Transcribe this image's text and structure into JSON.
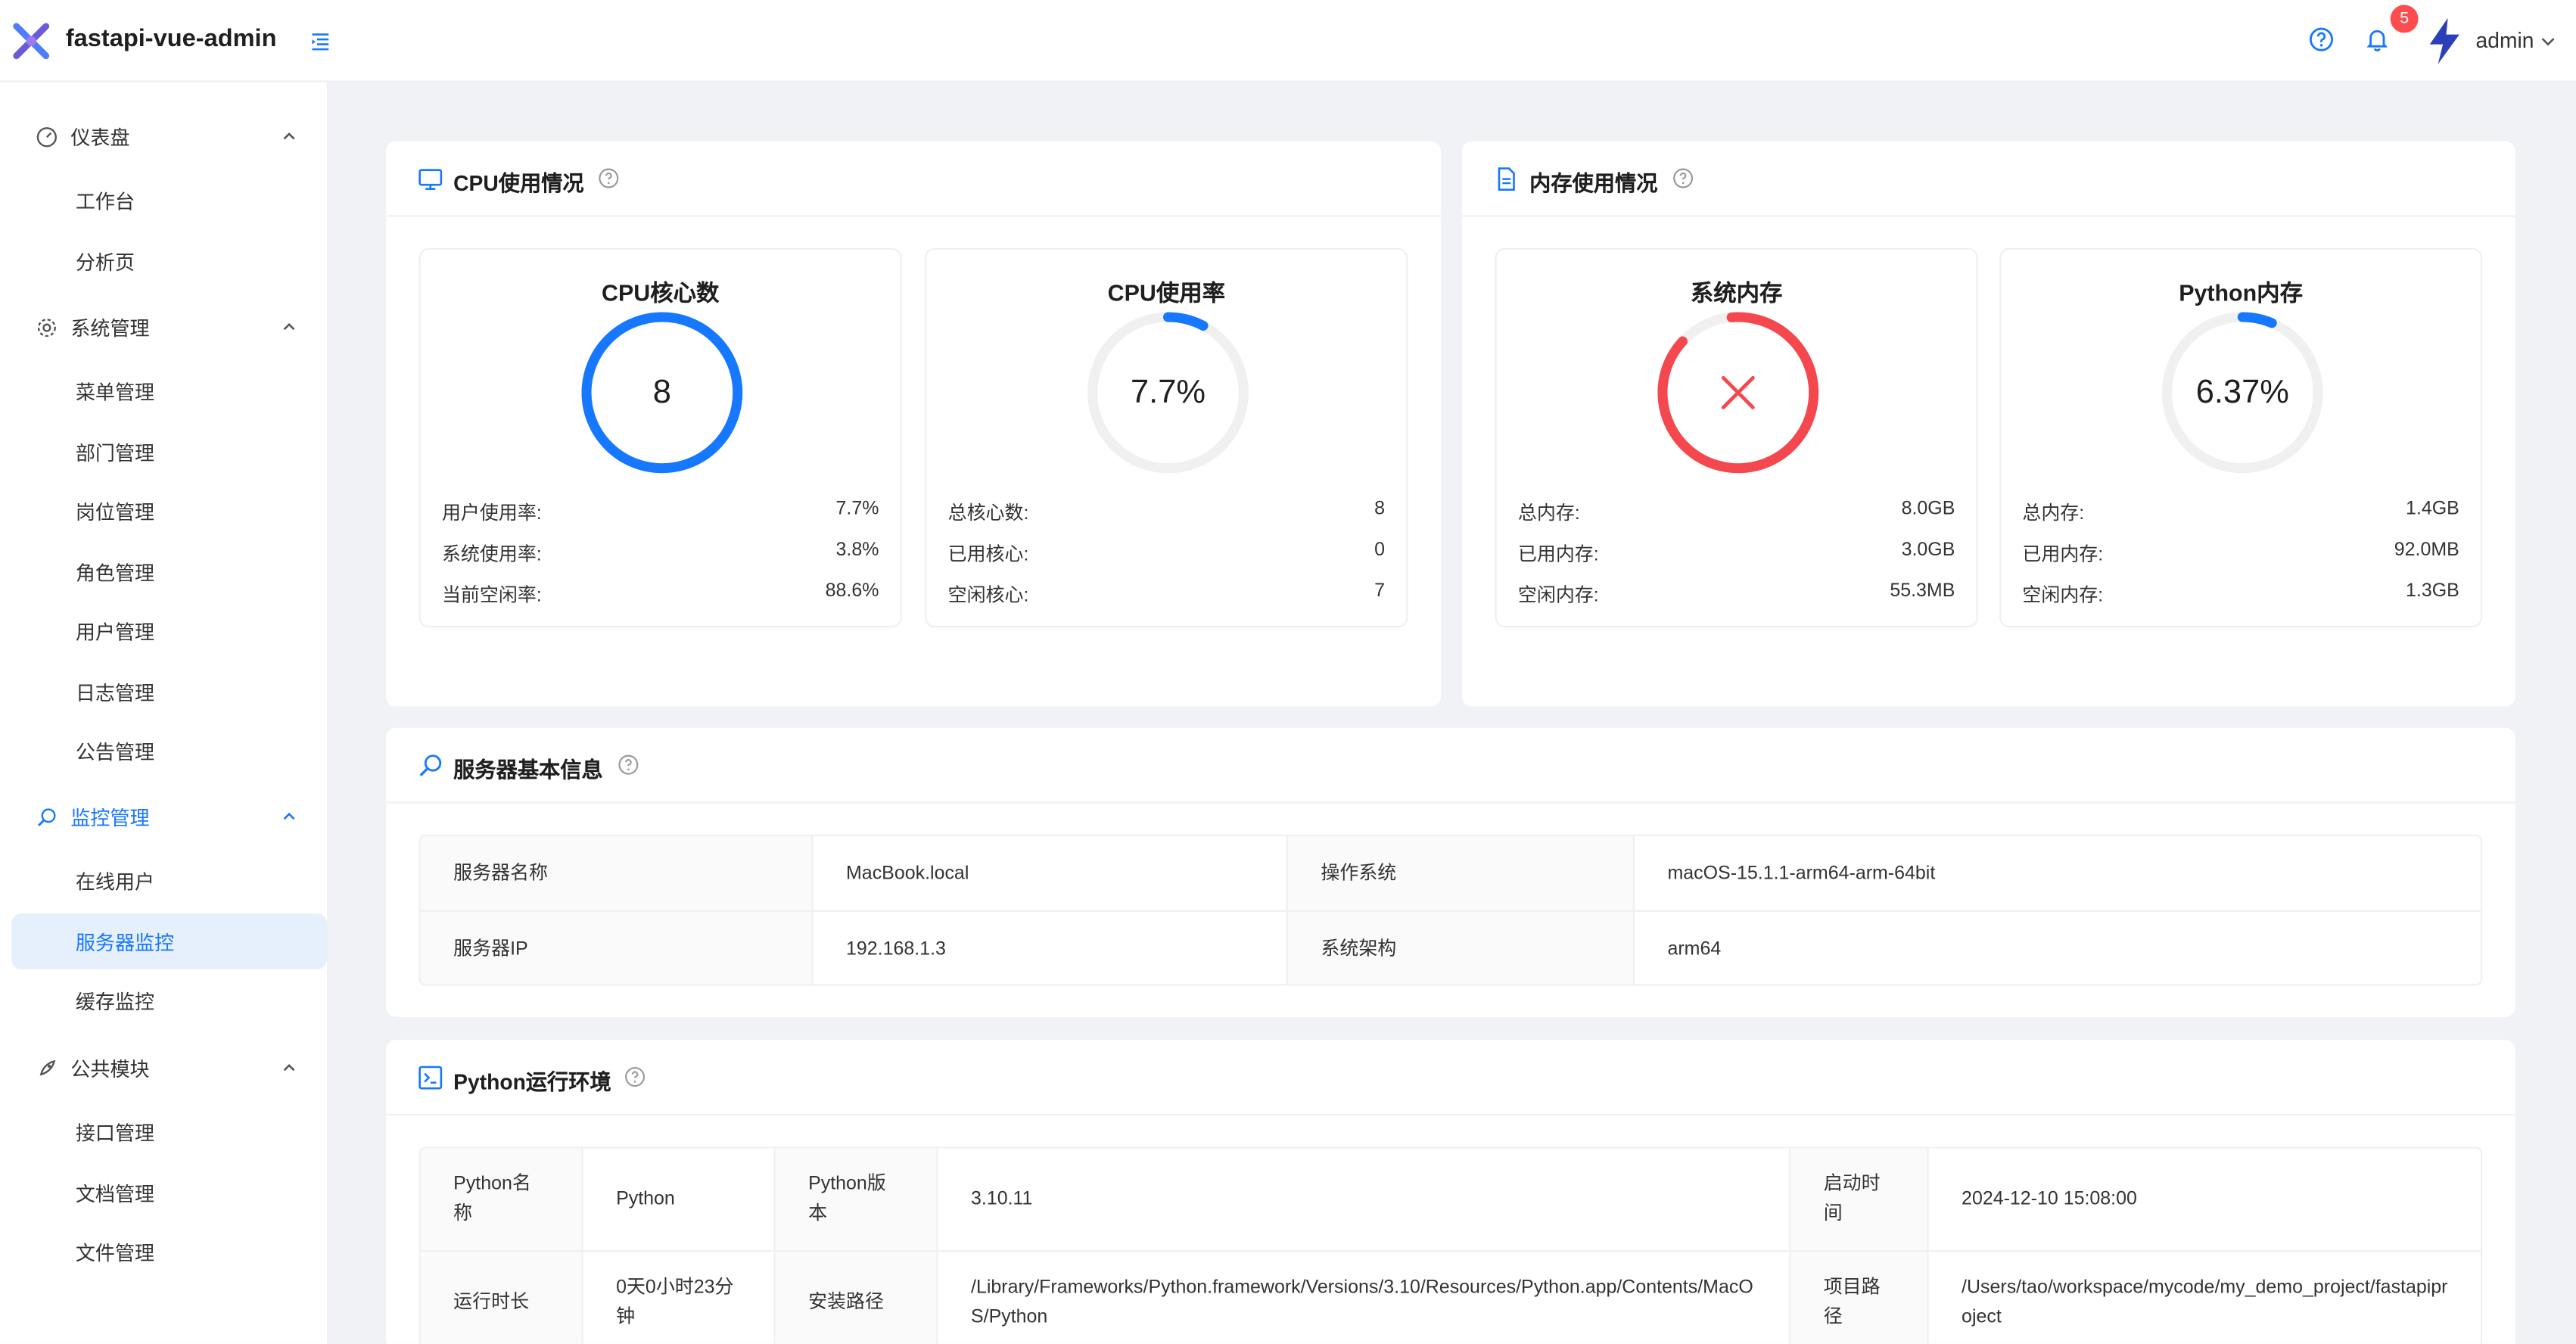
{
  "app": {
    "title": "fastapi-vue-admin"
  },
  "header": {
    "notification_count": "5",
    "user_name": "admin"
  },
  "sidebar": {
    "groups": [
      {
        "label": "仪表盘",
        "items": [
          "工作台",
          "分析页"
        ]
      },
      {
        "label": "系统管理",
        "items": [
          "菜单管理",
          "部门管理",
          "岗位管理",
          "角色管理",
          "用户管理",
          "日志管理",
          "公告管理"
        ]
      },
      {
        "label": "监控管理",
        "items": [
          "在线用户",
          "服务器监控",
          "缓存监控"
        ]
      },
      {
        "label": "公共模块",
        "items": [
          "接口管理",
          "文档管理",
          "文件管理"
        ]
      }
    ],
    "selected": "服务器监控"
  },
  "cpu_card": {
    "title": "CPU使用情况",
    "cores_box": {
      "title": "CPU核心数",
      "gauge_value": "8",
      "rows": [
        [
          "用户使用率:",
          "7.7%"
        ],
        [
          "系统使用率:",
          "3.8%"
        ],
        [
          "当前空闲率:",
          "88.6%"
        ]
      ]
    },
    "usage_box": {
      "title": "CPU使用率",
      "gauge_value": "7.7%",
      "percent": 7.7,
      "rows": [
        [
          "总核心数:",
          "8"
        ],
        [
          "已用核心:",
          "0"
        ],
        [
          "空闲核心:",
          "7"
        ]
      ]
    }
  },
  "memory_card": {
    "title": "内存使用情况",
    "system_box": {
      "title": "系统内存",
      "rows": [
        [
          "总内存:",
          "8.0GB"
        ],
        [
          "已用内存:",
          "3.0GB"
        ],
        [
          "空闲内存:",
          "55.3MB"
        ]
      ]
    },
    "python_box": {
      "title": "Python内存",
      "gauge_value": "6.37%",
      "percent": 6.37,
      "rows": [
        [
          "总内存:",
          "1.4GB"
        ],
        [
          "已用内存:",
          "92.0MB"
        ],
        [
          "空闲内存:",
          "1.3GB"
        ]
      ]
    }
  },
  "server_card": {
    "title": "服务器基本信息",
    "rows": [
      [
        "服务器名称",
        "MacBook.local",
        "操作系统",
        "macOS-15.1.1-arm64-arm-64bit"
      ],
      [
        "服务器IP",
        "192.168.1.3",
        "系统架构",
        "arm64"
      ]
    ]
  },
  "python_card": {
    "title": "Python运行环境",
    "row1": [
      "Python名称",
      "Python",
      "Python版本",
      "3.10.11",
      "启动时间",
      "2024-12-10 15:08:00"
    ],
    "row2": [
      "运行时长",
      "0天0小时23分钟",
      "安装路径",
      "/Library/Frameworks/Python.framework/Versions/3.10/Resources/Python.app/Contents/MacOS/Python",
      "项目路径",
      "/Users/tao/workspace/mycode/my_demo_project/fastapiproject"
    ]
  },
  "colors": {
    "primary": "#1677ff",
    "danger": "#f5484e",
    "track": "#f0f0f0"
  }
}
